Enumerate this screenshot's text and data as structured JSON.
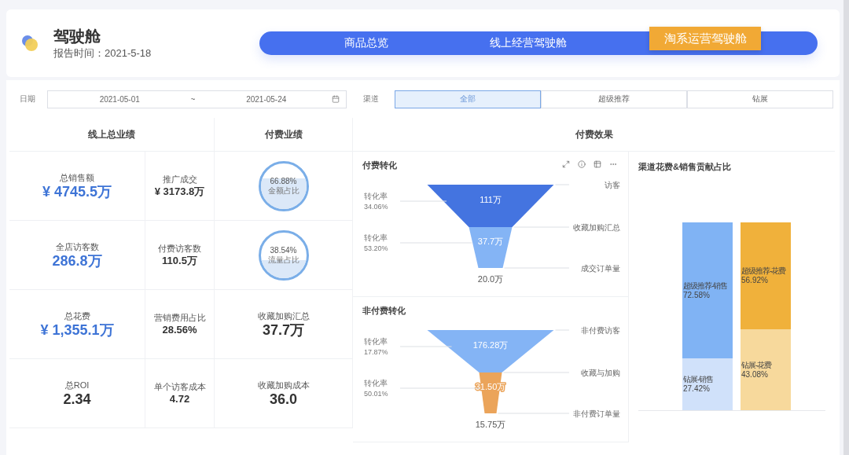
{
  "header": {
    "title": "驾驶舱",
    "report_time": "报告时间：2021-5-18",
    "tabs": [
      {
        "label": "商品总览",
        "selected": false
      },
      {
        "label": "线上经营驾驶舱",
        "selected": false
      },
      {
        "label": "淘系运营驾驶舱",
        "selected": true
      }
    ]
  },
  "filters": {
    "date_label": "日期",
    "date_start": "2021-05-01",
    "date_separator": "~",
    "date_end": "2021-05-24",
    "channel_label": "渠道",
    "channels": [
      {
        "label": "全部",
        "selected": true
      },
      {
        "label": "超级推荐",
        "selected": false
      },
      {
        "label": "钻展",
        "selected": false
      }
    ]
  },
  "overall": {
    "title": "线上总业绩",
    "rows": [
      {
        "main": {
          "label": "总销售额",
          "value": "¥ 4745.5万",
          "highlight": true
        },
        "side": {
          "label": "推广成交",
          "value": "¥ 3173.8万"
        }
      },
      {
        "main": {
          "label": "全店访客数",
          "value": "286.8万",
          "highlight": true
        },
        "side": {
          "label": "付费访客数",
          "value": "110.5万"
        }
      },
      {
        "main": {
          "label": "总花费",
          "value": "¥ 1,355.1万",
          "highlight": true
        },
        "side": {
          "label": "营销费用占比",
          "value": "28.56%"
        }
      },
      {
        "main": {
          "label": "总ROI",
          "value": "2.34",
          "highlight": false
        },
        "side": {
          "label": "单个访客成本",
          "value": "4.72"
        }
      }
    ]
  },
  "paid": {
    "title": "付费业绩",
    "items": [
      {
        "kind": "gauge",
        "value": "66.88%",
        "caption": "金额占比"
      },
      {
        "kind": "gauge",
        "value": "38.54%",
        "caption": "流量占比"
      },
      {
        "kind": "stat",
        "label": "收藏加购汇总",
        "value": "37.7万"
      },
      {
        "kind": "stat",
        "label": "收藏加购成本",
        "value": "36.0"
      }
    ]
  },
  "effect": {
    "title": "付费效果",
    "funnels": [
      {
        "title": "付费转化",
        "toolbar": true,
        "stages": [
          {
            "name": "访客",
            "value": "111万",
            "color": "#4474e0"
          },
          {
            "name": "收藏加购汇总",
            "value": "37.7万",
            "color": "#84b4f5"
          },
          {
            "name": "成交订单量",
            "value": "20.0万"
          }
        ],
        "rates": [
          {
            "label": "转化率",
            "value": "34.06%"
          },
          {
            "label": "转化率",
            "value": "53.20%"
          }
        ]
      },
      {
        "title": "非付费转化",
        "toolbar": false,
        "stages": [
          {
            "name": "非付费访客",
            "value": "176.28万",
            "color": "#84b4f5"
          },
          {
            "name": "收藏与加购",
            "value": "31.50万",
            "color": "#eba45a"
          },
          {
            "name": "非付费订单量",
            "value": "15.75万"
          }
        ],
        "rates": [
          {
            "label": "转化率",
            "value": "17.87%"
          },
          {
            "label": "转化率",
            "value": "50.01%"
          }
        ]
      }
    ],
    "share": {
      "title": "渠道花费&销售贡献占比",
      "bars": [
        {
          "segments": [
            {
              "name": "超级推荐-销售",
              "value": "72.58%",
              "color": "#80b3f4"
            },
            {
              "name": "钻展-销售",
              "value": "27.42%",
              "color": "#d0e1fa"
            }
          ]
        },
        {
          "segments": [
            {
              "name": "超级推荐-花费",
              "value": "56.92%",
              "color": "#f0b13b"
            },
            {
              "name": "钻展-花费",
              "value": "43.08%",
              "color": "#f7d99c"
            }
          ]
        }
      ]
    }
  }
}
